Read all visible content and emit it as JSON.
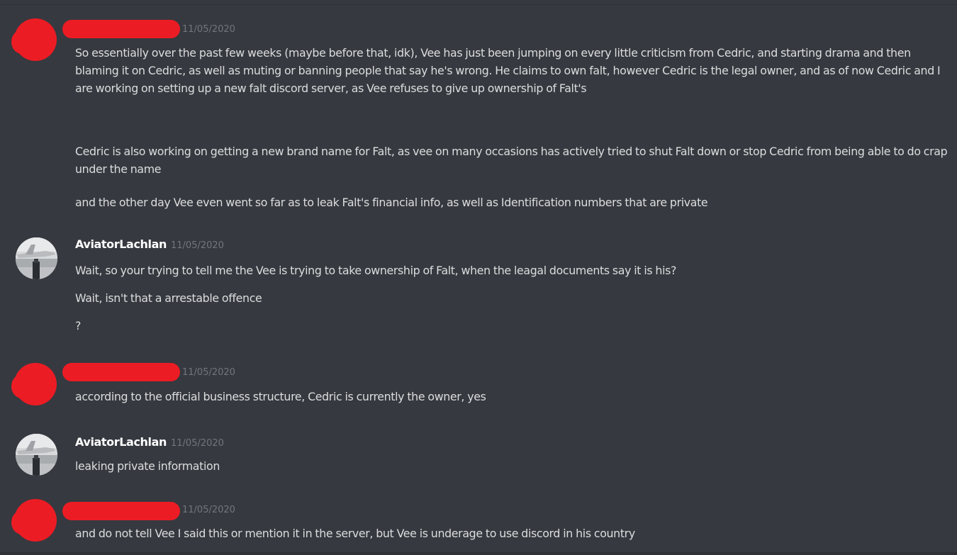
{
  "colors": {
    "background": "#36393f",
    "text": "#dcddde",
    "username": "#ffffff",
    "timestamp": "#72767d",
    "redaction": "#ec1c24"
  },
  "messages": [
    {
      "author": "",
      "author_redacted": true,
      "avatar": "redacted-avatar",
      "timestamp": "11/05/2020",
      "lines": [
        "So essentially over the past few weeks (maybe before that, idk), Vee has just been jumping on every little criticism from Cedric, and starting drama and then blaming it on Cedric, as well as muting or banning people that say he's wrong. He claims to own falt, however Cedric is the legal owner, and as of now Cedric and I are working on setting up a new falt discord server, as Vee refuses to give up ownership of Falt's",
        "Cedric is also working on getting a new brand name for Falt, as vee on many occasions has actively tried to shut Falt down or stop Cedric from being able to do crap under the name",
        "and the other day Vee even went so far as to leak Falt's financial info, as well as Identification numbers that are private"
      ]
    },
    {
      "author": "AviatorLachlan",
      "author_redacted": false,
      "avatar": "aircraft-photo-avatar",
      "timestamp": "11/05/2020",
      "lines": [
        "Wait, so your trying to tell me the Vee is trying to take ownership of Falt, when the leagal documents say it is his?",
        "Wait, isn't that a arrestable offence",
        "?"
      ]
    },
    {
      "author": "",
      "author_redacted": true,
      "avatar": "redacted-avatar",
      "timestamp": "11/05/2020",
      "lines": [
        "according to the official business structure, Cedric is currently the owner, yes"
      ]
    },
    {
      "author": "AviatorLachlan",
      "author_redacted": false,
      "avatar": "aircraft-photo-avatar",
      "timestamp": "11/05/2020",
      "lines": [
        "leaking private information"
      ]
    },
    {
      "author": "",
      "author_redacted": true,
      "avatar": "redacted-avatar",
      "timestamp": "11/05/2020",
      "lines": [
        "and do not tell Vee I said this or mention it in the server, but Vee is underage to use discord in his country"
      ]
    }
  ]
}
